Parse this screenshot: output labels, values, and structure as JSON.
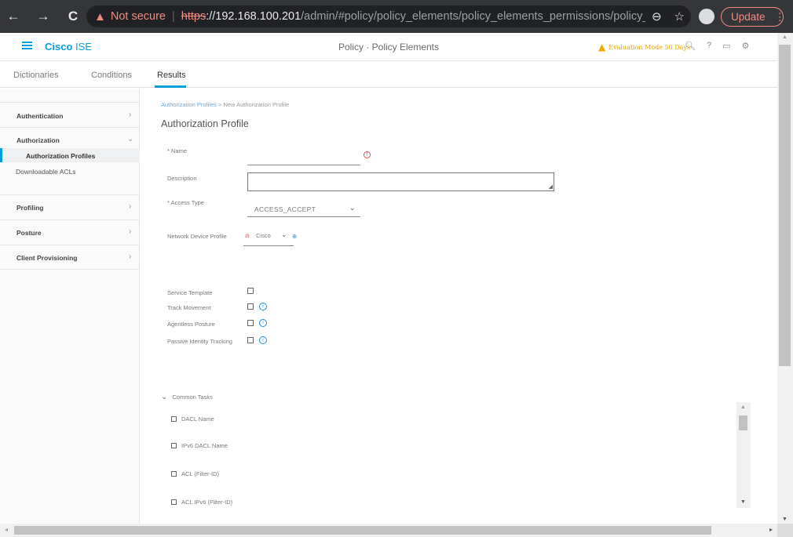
{
  "browser": {
    "back": "←",
    "forward": "→",
    "reload": "C",
    "not_secure": "Not secure",
    "url_scheme": "https",
    "url_host": "://192.168.100.201",
    "url_path": "/admin/#policy/policy_elements/policy_elements_permissions/policy_el...",
    "update_label": "Update"
  },
  "header": {
    "brand_bold": "Cisco",
    "brand_light": " ISE",
    "title": "Policy · Policy Elements",
    "eval_text": "Evaluation Mode 50 Days"
  },
  "tabs": [
    {
      "label": "Dictionaries"
    },
    {
      "label": "Conditions"
    },
    {
      "label": "Results"
    }
  ],
  "sidebar": {
    "authentication": "Authentication",
    "authorization": "Authorization",
    "authorization_profiles": "Authorization Profiles",
    "downloadable_acls": "Downloadable ACLs",
    "profiling": "Profiling",
    "posture": "Posture",
    "client_provisioning": "Client Provisioning"
  },
  "content": {
    "breadcrumb_link": "Authorization Profiles",
    "breadcrumb_sep": " > ",
    "breadcrumb_current": "New Authorization Profile",
    "title": "Authorization Profile",
    "name_label": "* Name",
    "name_value": "",
    "description_label": "Description",
    "description_value": "",
    "access_type_label": "* Access Type",
    "access_type_value": "ACCESS_ACCEPT",
    "ndp_label": "Network Device Profile",
    "ndp_value": "Cisco",
    "service_template_label": "Service Template",
    "track_movement_label": "Track Movement",
    "agentless_posture_label": "Agentless Posture",
    "passive_identity_label": "Passive Identity Tracking",
    "common_tasks_label": "Common Tasks",
    "tasks": [
      {
        "label": "DACL Name"
      },
      {
        "label": "IPv6 DACL Name"
      },
      {
        "label": "ACL  (Filter-ID)"
      },
      {
        "label": "ACL IPv6 (Filter-ID)"
      }
    ]
  },
  "colors": {
    "accent": "#049fd9",
    "warning": "#f2a900",
    "error": "#e34d4d"
  }
}
